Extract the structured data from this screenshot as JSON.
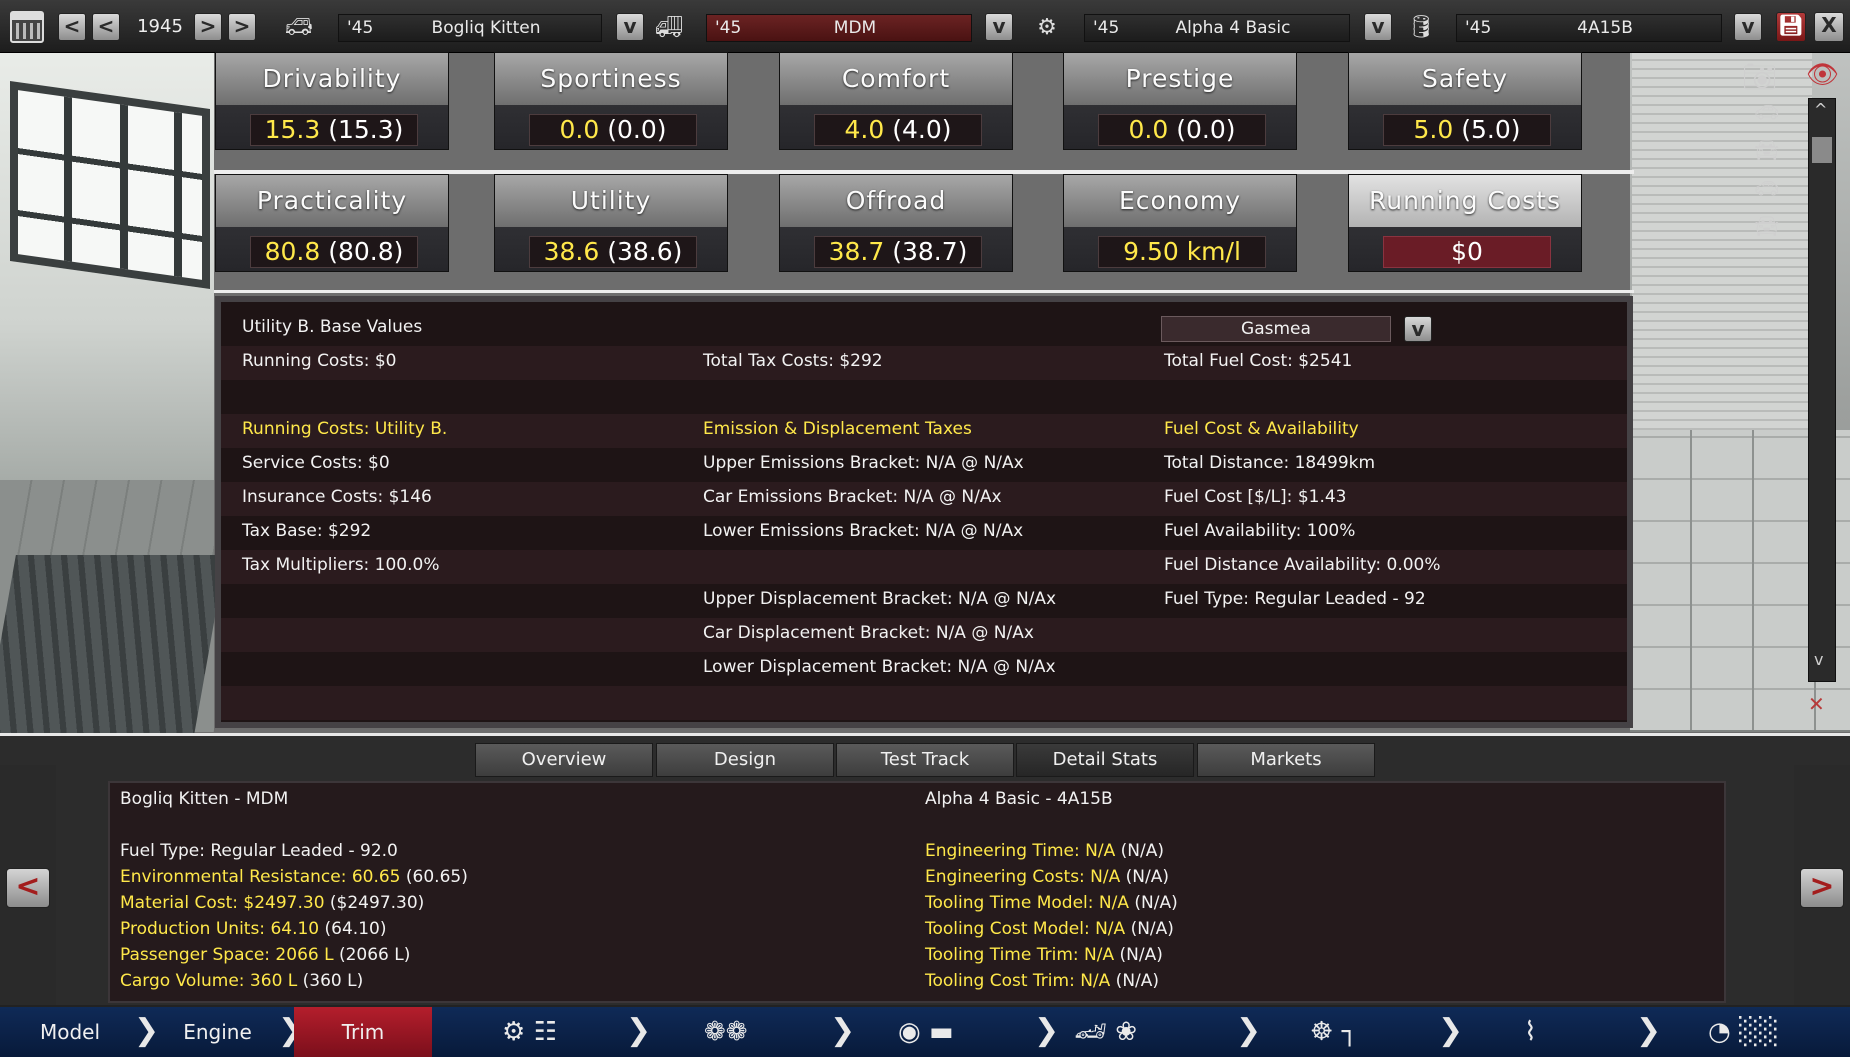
{
  "topbar": {
    "year": "1945",
    "prev_fast": "<",
    "prev": "<",
    "next": ">",
    "next_fast": ">",
    "model": {
      "year": "'45",
      "name": "Bogliq Kitten"
    },
    "trim": {
      "year": "'45",
      "name": "MDM"
    },
    "engine_family": {
      "year": "'45",
      "name": "Alpha 4 Basic"
    },
    "engine_variant": {
      "year": "'45",
      "name": "4A15B"
    },
    "dropdown_glyph": "v",
    "close": "X"
  },
  "stats_row1": [
    {
      "label": "Drivability",
      "value": "15.3",
      "paren": "(15.3)"
    },
    {
      "label": "Sportiness",
      "value": "0.0",
      "paren": "(0.0)"
    },
    {
      "label": "Comfort",
      "value": "4.0",
      "paren": "(4.0)"
    },
    {
      "label": "Prestige",
      "value": "0.0",
      "paren": "(0.0)"
    },
    {
      "label": "Safety",
      "value": "5.0",
      "paren": "(5.0)"
    }
  ],
  "stats_row2": [
    {
      "label": "Practicality",
      "value": "80.8",
      "paren": "(80.8)"
    },
    {
      "label": "Utility",
      "value": "38.6",
      "paren": "(38.6)"
    },
    {
      "label": "Offroad",
      "value": "38.7",
      "paren": "(38.7)"
    },
    {
      "label": "Economy",
      "value": "9.50 km/l",
      "paren": ""
    },
    {
      "label": "Running Costs",
      "value": "$0",
      "paren": ""
    }
  ],
  "detail": {
    "header": "Utility B. Base Values",
    "region": "Gasmea",
    "summary": {
      "running_costs": "Running Costs: $0",
      "total_tax": "Total Tax Costs: $292",
      "total_fuel": "Total Fuel Cost: $2541"
    },
    "col1": {
      "title": "Running Costs: Utility B.",
      "lines": [
        "Service Costs: $0",
        "Insurance Costs: $146",
        "Tax Base: $292",
        "Tax Multipliers: 100.0%"
      ]
    },
    "col2": {
      "title": "Emission & Displacement Taxes",
      "lines": [
        "Upper Emissions Bracket: N/A @ N/Ax",
        "Car Emissions Bracket: N/A @ N/Ax",
        "Lower Emissions Bracket: N/A @ N/Ax",
        "",
        "Upper Displacement Bracket: N/A @ N/Ax",
        "Car Displacement Bracket: N/A @ N/Ax",
        "Lower Displacement Bracket: N/A @ N/Ax"
      ]
    },
    "col3": {
      "title": "Fuel Cost & Availability",
      "lines": [
        "Total Distance: 18499km",
        "Fuel Cost [$/L]: $1.43",
        "Fuel Availability: 100%",
        "Fuel Distance Availability: 0.00%",
        "Fuel Type: Regular Leaded - 92"
      ]
    }
  },
  "tabs": [
    "Overview",
    "Design",
    "Test Track",
    "Detail Stats",
    "Markets"
  ],
  "active_tab": "Detail Stats",
  "bottom": {
    "left_title": "Bogliq Kitten - MDM",
    "right_title": "Alpha 4 Basic - 4A15B",
    "left_lines": [
      {
        "label": "Fuel Type: Regular Leaded - 92.0",
        "paren": "",
        "highlight": false
      },
      {
        "label": "Environmental Resistance: 60.65",
        "paren": " (60.65)",
        "highlight": true
      },
      {
        "label": "Material Cost: $2497.30",
        "paren": " ($2497.30)",
        "highlight": true
      },
      {
        "label": "Production Units: 64.10",
        "paren": " (64.10)",
        "highlight": true
      },
      {
        "label": "Passenger Space: 2066 L",
        "paren": " (2066 L)",
        "highlight": true
      },
      {
        "label": "Cargo Volume: 360 L",
        "paren": " (360 L)",
        "highlight": true
      }
    ],
    "right_lines": [
      {
        "label": "Engineering Time: N/A",
        "paren": " (N/A)"
      },
      {
        "label": "Engineering Costs: N/A",
        "paren": " (N/A)"
      },
      {
        "label": "Tooling Time Model: N/A",
        "paren": " (N/A)"
      },
      {
        "label": "Tooling Cost Model: N/A",
        "paren": " (N/A)"
      },
      {
        "label": "Tooling Time Trim: N/A",
        "paren": " (N/A)"
      },
      {
        "label": "Tooling Cost Trim: N/A",
        "paren": " (N/A)"
      }
    ],
    "prev": "<",
    "next": ">"
  },
  "footer": {
    "steps": [
      "Model",
      "Engine",
      "Trim"
    ],
    "active_step": "Trim",
    "chevron": "❯"
  },
  "colors": {
    "highlight": "#ffe84a",
    "accent_red": "#b41e2c",
    "footer_blue": "#0f2a57"
  }
}
